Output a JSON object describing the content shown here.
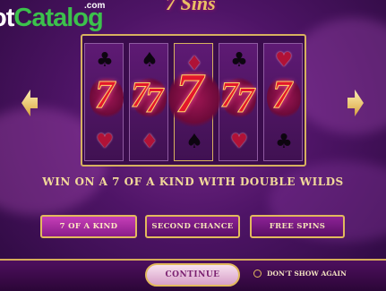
{
  "watermark": {
    "part1": "ot",
    "part2": "Catalog",
    "domain": ".com"
  },
  "game_logo": "7 Sins",
  "reels": [
    {
      "top": "♣",
      "bottom": "♥",
      "top_color": "dark",
      "bottom_color": "red"
    },
    {
      "top": "♠",
      "bottom": "♦",
      "top_color": "dark",
      "bottom_color": "red"
    },
    {
      "top": "♦",
      "bottom": "♠",
      "top_color": "red",
      "bottom_color": "dark"
    },
    {
      "top": "♣",
      "bottom": "♥",
      "top_color": "dark",
      "bottom_color": "red"
    },
    {
      "top": "♥",
      "bottom": "♣",
      "top_color": "red",
      "bottom_color": "dark"
    }
  ],
  "seven_symbol": "7",
  "feature_text": "WIN ON A 7 OF A KIND WITH DOUBLE WILDS",
  "feature_buttons": [
    {
      "label": "7 OF A KIND",
      "active": true
    },
    {
      "label": "SECOND CHANCE",
      "active": false
    },
    {
      "label": "FREE SPINS",
      "active": false
    }
  ],
  "continue_label": "CONTINUE",
  "dont_show_label": "DON'T SHOW AGAIN",
  "colors": {
    "gold": "#d7b15f",
    "purple_bg": "#4e1466",
    "seven_red": "#e3172c"
  }
}
